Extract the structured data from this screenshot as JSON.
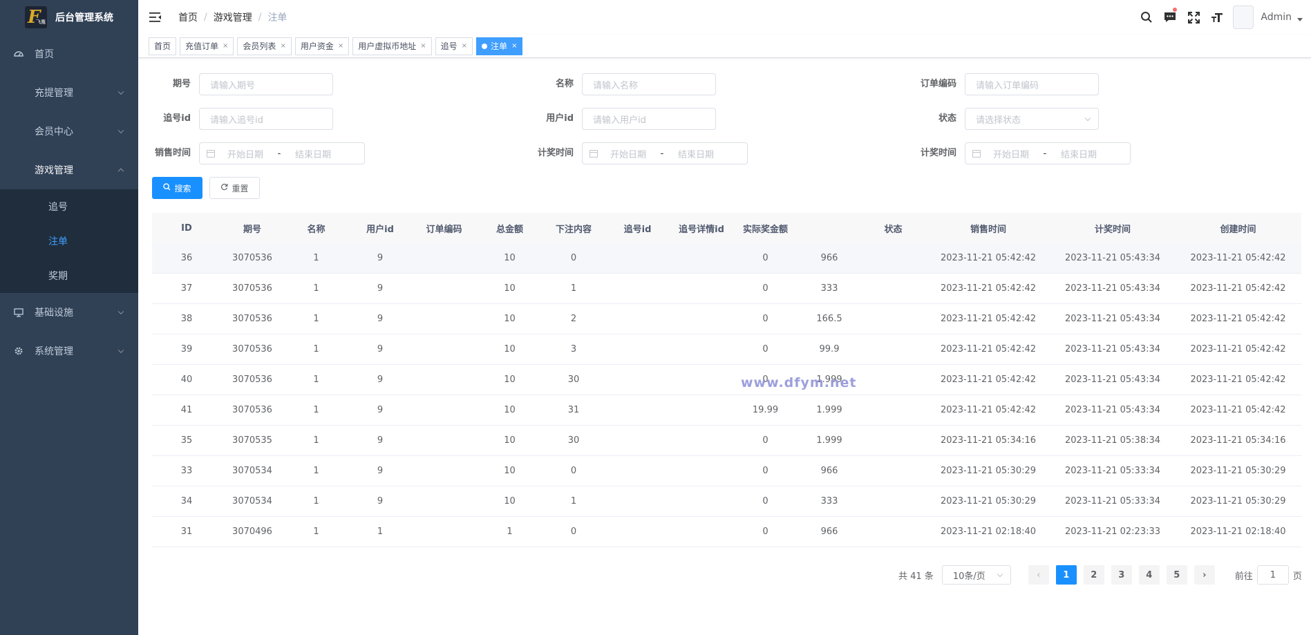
{
  "app": {
    "title": "后台管理系统",
    "logo_text": "飞鹰"
  },
  "sidebar": {
    "items": [
      {
        "label": "首页"
      },
      {
        "label": "充提管理"
      },
      {
        "label": "会员中心"
      },
      {
        "label": "游戏管理"
      },
      {
        "label": "基础设施"
      },
      {
        "label": "系统管理"
      }
    ],
    "sub_items": [
      {
        "label": "追号"
      },
      {
        "label": "注单"
      },
      {
        "label": "奖期"
      }
    ]
  },
  "breadcrumb": [
    "首页",
    "游戏管理",
    "注单"
  ],
  "header": {
    "username": "Admin"
  },
  "tags": [
    {
      "label": "首页"
    },
    {
      "label": "充值订单"
    },
    {
      "label": "会员列表"
    },
    {
      "label": "用户资金"
    },
    {
      "label": "用户虚拟币地址"
    },
    {
      "label": "追号"
    },
    {
      "label": "注单"
    }
  ],
  "tag_close": "×",
  "form": {
    "period": {
      "label": "期号",
      "placeholder": "请输入期号"
    },
    "name": {
      "label": "名称",
      "placeholder": "请输入名称"
    },
    "order_no": {
      "label": "订单编码",
      "placeholder": "请输入订单编码"
    },
    "chase_id": {
      "label": "追号id",
      "placeholder": "请输入追号id"
    },
    "user_id": {
      "label": "用户id",
      "placeholder": "请输入用户id"
    },
    "status": {
      "label": "状态",
      "placeholder": "请选择状态"
    },
    "sale_time": {
      "label": "销售时间",
      "start": "开始日期",
      "end": "结束日期",
      "sep": "-"
    },
    "prize_time_1": {
      "label": "计奖时间",
      "start": "开始日期",
      "end": "结束日期",
      "sep": "-"
    },
    "prize_time_2": {
      "label": "计奖时间",
      "start": "开始日期",
      "end": "结束日期",
      "sep": "-"
    },
    "search_label": "搜索",
    "reset_label": "重置"
  },
  "table": {
    "columns": [
      "ID",
      "期号",
      "名称",
      "用户id",
      "订单编码",
      "总金额",
      "下注内容",
      "追号id",
      "追号详情id",
      "实际奖金额",
      "",
      "状态",
      "销售时间",
      "计奖时间",
      "创建时间"
    ],
    "rows": [
      [
        "36",
        "3070536",
        "1",
        "9",
        "",
        "10",
        "0",
        "",
        "",
        "0",
        "966",
        "",
        "2023-11-21 05:42:42",
        "2023-11-21 05:43:34",
        "2023-11-21 05:42:42"
      ],
      [
        "37",
        "3070536",
        "1",
        "9",
        "",
        "10",
        "1",
        "",
        "",
        "0",
        "333",
        "",
        "2023-11-21 05:42:42",
        "2023-11-21 05:43:34",
        "2023-11-21 05:42:42"
      ],
      [
        "38",
        "3070536",
        "1",
        "9",
        "",
        "10",
        "2",
        "",
        "",
        "0",
        "166.5",
        "",
        "2023-11-21 05:42:42",
        "2023-11-21 05:43:34",
        "2023-11-21 05:42:42"
      ],
      [
        "39",
        "3070536",
        "1",
        "9",
        "",
        "10",
        "3",
        "",
        "",
        "0",
        "99.9",
        "",
        "2023-11-21 05:42:42",
        "2023-11-21 05:43:34",
        "2023-11-21 05:42:42"
      ],
      [
        "40",
        "3070536",
        "1",
        "9",
        "",
        "10",
        "30",
        "",
        "",
        "0",
        "1.999",
        "",
        "2023-11-21 05:42:42",
        "2023-11-21 05:43:34",
        "2023-11-21 05:42:42"
      ],
      [
        "41",
        "3070536",
        "1",
        "9",
        "",
        "10",
        "31",
        "",
        "",
        "19.99",
        "1.999",
        "",
        "2023-11-21 05:42:42",
        "2023-11-21 05:43:34",
        "2023-11-21 05:42:42"
      ],
      [
        "35",
        "3070535",
        "1",
        "9",
        "",
        "10",
        "30",
        "",
        "",
        "0",
        "1.999",
        "",
        "2023-11-21 05:34:16",
        "2023-11-21 05:38:34",
        "2023-11-21 05:34:16"
      ],
      [
        "33",
        "3070534",
        "1",
        "9",
        "",
        "10",
        "0",
        "",
        "",
        "0",
        "966",
        "",
        "2023-11-21 05:30:29",
        "2023-11-21 05:33:34",
        "2023-11-21 05:30:29"
      ],
      [
        "34",
        "3070534",
        "1",
        "9",
        "",
        "10",
        "1",
        "",
        "",
        "0",
        "333",
        "",
        "2023-11-21 05:30:29",
        "2023-11-21 05:33:34",
        "2023-11-21 05:30:29"
      ],
      [
        "31",
        "3070496",
        "1",
        "1",
        "",
        "1",
        "0",
        "",
        "",
        "0",
        "966",
        "",
        "2023-11-21 02:18:40",
        "2023-11-21 02:23:33",
        "2023-11-21 02:18:40"
      ]
    ]
  },
  "pagination": {
    "total_text": "共 41 条",
    "page_size": "10条/页",
    "pages": [
      "1",
      "2",
      "3",
      "4",
      "5"
    ],
    "current": "1",
    "prev": "‹",
    "next": "›",
    "jump_prefix": "前往",
    "jump_value": "1",
    "jump_suffix": "页"
  },
  "watermark": "www.dfym.net",
  "colors": {
    "sidebar_bg": "#304156",
    "submenu_bg": "#1f2d3d",
    "primary": "#1890ff",
    "active_text": "#409eff"
  }
}
